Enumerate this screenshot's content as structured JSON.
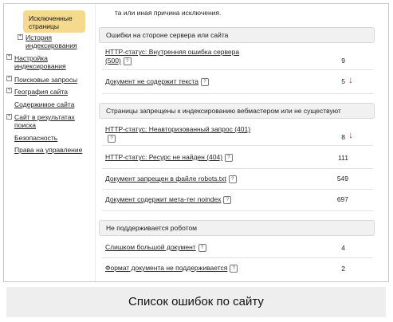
{
  "sidebar": {
    "selected": "Исключенные страницы",
    "items": [
      {
        "label": "История индексирования",
        "expandable": true
      },
      {
        "label": "Настройка индексирования",
        "expandable": true
      },
      {
        "label": "Поисковые запросы",
        "expandable": true
      },
      {
        "label": "География сайта",
        "expandable": true
      },
      {
        "label": "Содержимое сайта",
        "expandable": false
      },
      {
        "label": "Сайт в результатах поиска",
        "expandable": true
      },
      {
        "label": "Безопасность",
        "expandable": false
      },
      {
        "label": "Права на управление",
        "expandable": false
      }
    ]
  },
  "main": {
    "intro_text": "та или иная причина исключения.",
    "sections": [
      {
        "title": "Ошибки на стороне сервера или сайта",
        "rows": [
          {
            "label": "HTTP-статус: Внутренняя ошибка сервера (500)",
            "count": "9",
            "trend": ""
          },
          {
            "label": "Документ не содержит текста",
            "count": "5",
            "trend": "down"
          }
        ]
      },
      {
        "title": "Страницы запрещены к индексированию вебмастером или не существуют",
        "rows": [
          {
            "label": "HTTP-статус: Неавторизованный запрос (401)",
            "count": "8",
            "trend": "down"
          },
          {
            "label": "HTTP-статус: Ресурс не найден (404)",
            "count": "111",
            "trend": ""
          },
          {
            "label": "Документ запрещен в файле robots.txt",
            "count": "549",
            "trend": ""
          },
          {
            "label": "Документ содержит мета-тег noindex",
            "count": "697",
            "trend": ""
          }
        ]
      },
      {
        "title": "Не поддерживается роботом",
        "rows": [
          {
            "label": "Слишком большой документ",
            "count": "4",
            "trend": ""
          },
          {
            "label": "Формат документа не поддерживается",
            "count": "2",
            "trend": ""
          }
        ]
      }
    ],
    "help_icon_glyph": "?",
    "trend_down_glyph": "↓"
  },
  "caption": "Список ошибок по сайту"
}
